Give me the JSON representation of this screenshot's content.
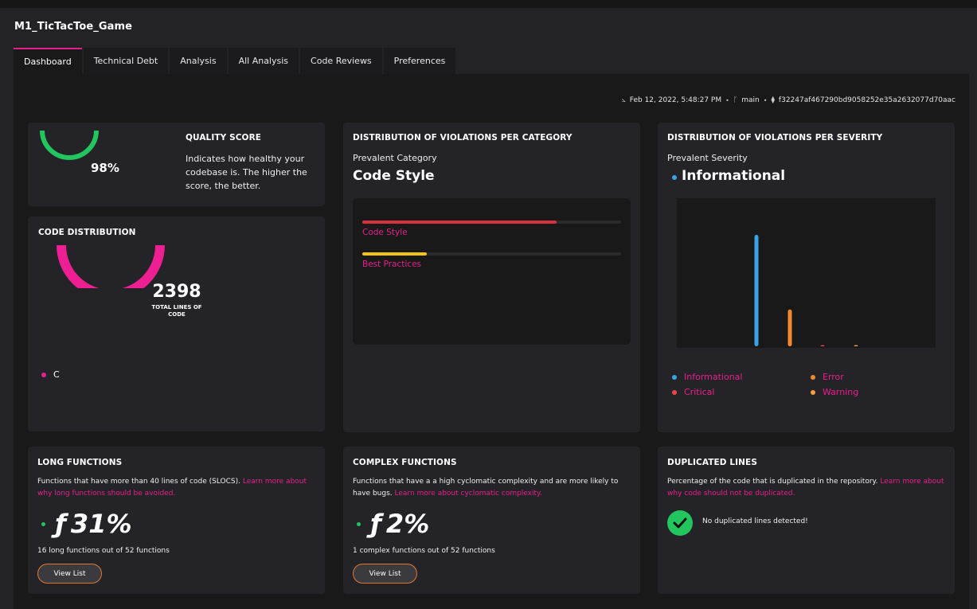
{
  "repo_title": "M1_TicTacToe_Game",
  "tabs": [
    "Dashboard",
    "Technical Debt",
    "Analysis",
    "All Analysis",
    "Code Reviews",
    "Preferences"
  ],
  "meta": {
    "date": "Feb 12, 2022, 5:48:27 PM",
    "branch": "main",
    "commit": "f32247af467290bd9058252e35a2632077d70aac"
  },
  "quality": {
    "title": "QUALITY SCORE",
    "value": "98%",
    "score_fraction": 0.98,
    "description": "Indicates how healthy your codebase is. The higher the score, the better."
  },
  "code_distribution": {
    "title": "CODE DISTRIBUTION",
    "total": "2398",
    "total_label": "TOTAL LINES OF CODE",
    "languages": [
      "C"
    ]
  },
  "category": {
    "title": "DISTRIBUTION OF VIOLATIONS PER CATEGORY",
    "prevalent_label": "Prevalent Category",
    "prevalent_value": "Code Style",
    "bars": [
      {
        "label": "Code Style",
        "fraction": 0.75,
        "color": "#d6313d"
      },
      {
        "label": "Best Practices",
        "fraction": 0.25,
        "color": "#f3c316"
      }
    ]
  },
  "severity": {
    "title": "DISTRIBUTION OF VIOLATIONS PER SEVERITY",
    "prevalent_label": "Prevalent Severity",
    "prevalent_value": "Informational",
    "legend": [
      {
        "label": "Informational",
        "color": "#3aa3e3"
      },
      {
        "label": "Error",
        "color": "#f08a2c"
      },
      {
        "label": "Critical",
        "color": "#ef4444"
      },
      {
        "label": "Warning",
        "color": "#f4a23a"
      }
    ]
  },
  "chart_data": {
    "type": "bar",
    "categories": [
      "Informational",
      "Error",
      "Critical",
      "Warning"
    ],
    "values": [
      1.0,
      0.33,
      0.01,
      0.01
    ],
    "colors": [
      "#3aa3e3",
      "#f08a2c",
      "#ef4444",
      "#f4a23a"
    ],
    "title": "",
    "xlabel": "",
    "ylabel": "",
    "grid": false
  },
  "long_functions": {
    "title": "LONG FUNCTIONS",
    "desc": "Functions that have more than 40 lines of code (SLOCS).",
    "link": "Learn more about why long functions should be avoided.",
    "icon": "ƒ",
    "value": "31%",
    "summary": "16 long functions out of 52 functions",
    "button": "View List"
  },
  "complex_functions": {
    "title": "COMPLEX FUNCTIONS",
    "desc": "Functions that have a a high cyclomatic complexity and are more likely to have bugs.",
    "link": "Learn more about cyclomatic complexity.",
    "icon": "ƒ",
    "value": "2%",
    "summary": "1 complex functions out of 52 functions",
    "button": "View List"
  },
  "duplicated": {
    "title": "DUPLICATED LINES",
    "desc": "Percentage of the code that is duplicated in the repository.",
    "link": "Learn more about why code should not be duplicated.",
    "status": "No duplicated lines detected!"
  },
  "colors": {
    "accent": "#e91e8c",
    "good": "#22c55e"
  }
}
